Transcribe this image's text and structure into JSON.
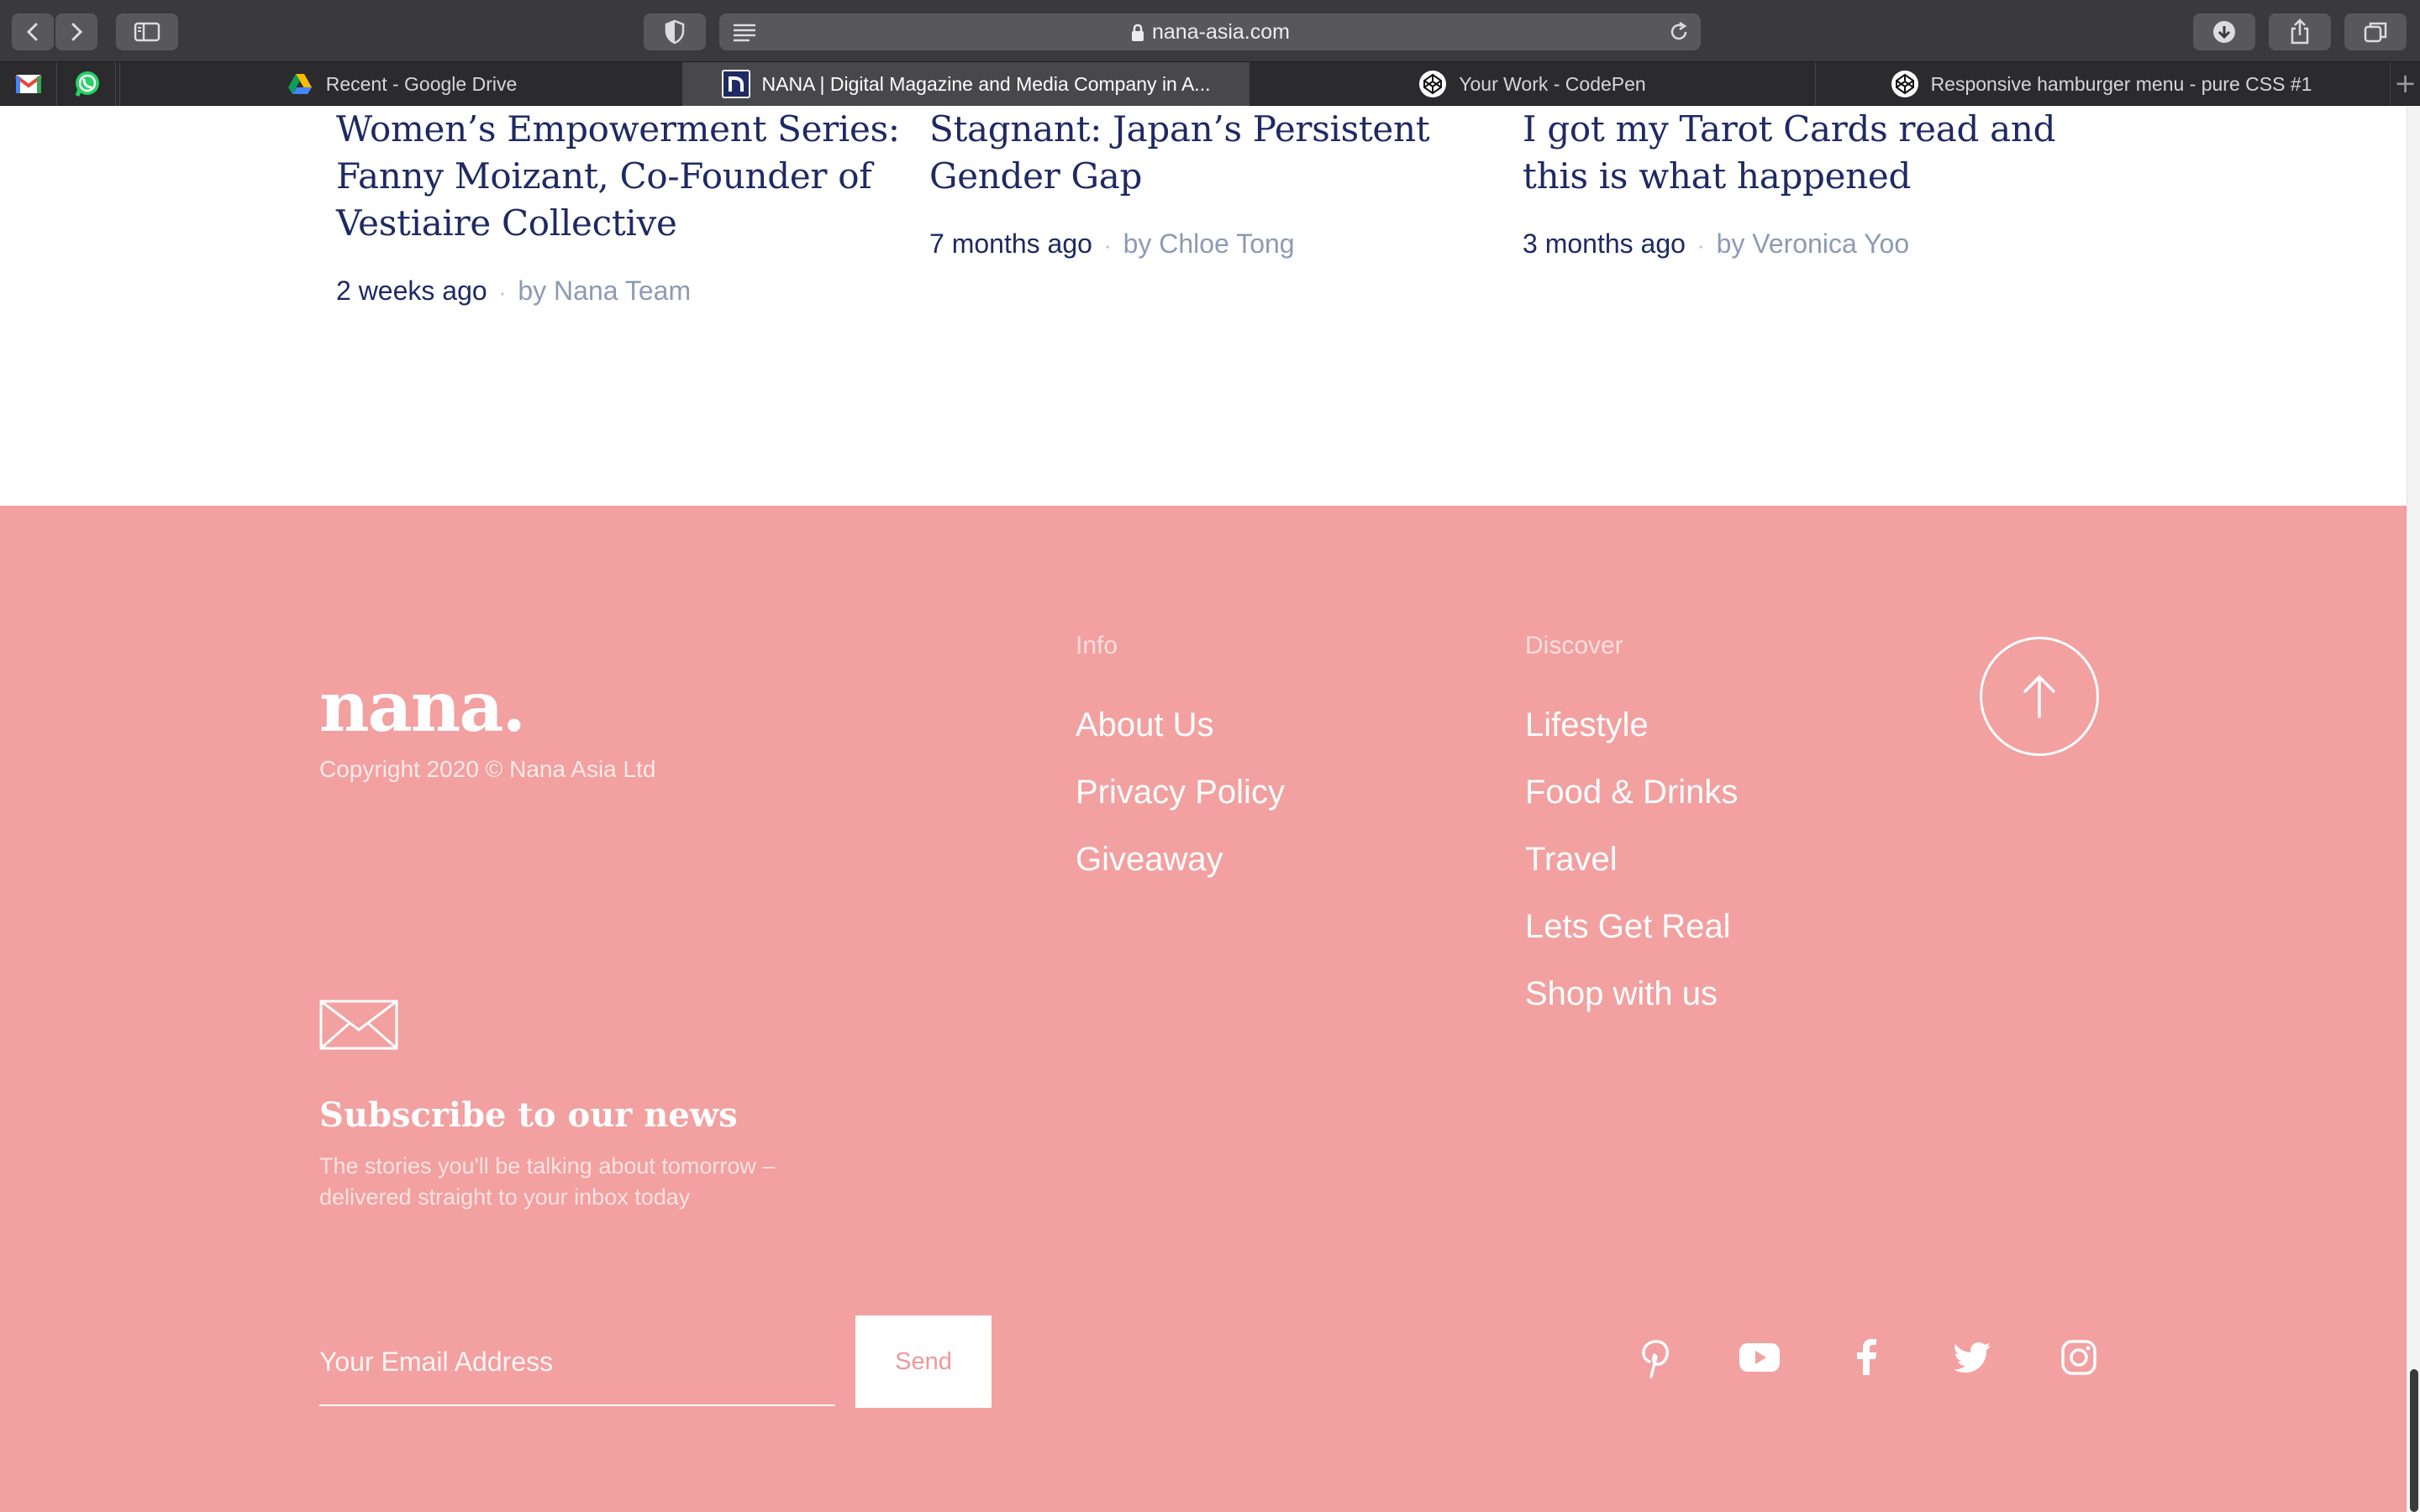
{
  "browser": {
    "url": "nana-asia.com",
    "tabs": [
      {
        "label": "Recent - Google Drive",
        "icon": "google-drive-icon",
        "active": false
      },
      {
        "label": "NANA | Digital Magazine and Media Company in A...",
        "icon": "nana-favicon-icon",
        "active": true
      },
      {
        "label": "Your Work - CodePen",
        "icon": "codepen-icon",
        "active": false
      },
      {
        "label": "Responsive hamburger menu - pure CSS #1",
        "icon": "codepen-icon",
        "active": false
      }
    ],
    "pinned": [
      "gmail-icon",
      "whatsapp-icon"
    ],
    "new_tab_label": "+"
  },
  "articles": [
    {
      "title": "Women’s Empowerment Series: Fanny Moizant, Co-Founder of Vestiaire Collective",
      "time": "2 weeks ago",
      "author": "by Nana Team"
    },
    {
      "title": "Stagnant: Japan’s Persistent Gender Gap",
      "time": "7 months ago",
      "author": "by Chloe Tong"
    },
    {
      "title": "I got my Tarot Cards read and this is what happened",
      "time": "3 months ago",
      "author": "by Veronica Yoo"
    }
  ],
  "footer": {
    "logo": "nana.",
    "copyright": "Copyright 2020 © Nana Asia Ltd",
    "info": {
      "heading": "Info",
      "links": [
        "About Us",
        "Privacy Policy",
        "Giveaway"
      ]
    },
    "discover": {
      "heading": "Discover",
      "links": [
        "Lifestyle",
        "Food & Drinks",
        "Travel",
        "Lets Get Real",
        "Shop with us"
      ]
    },
    "subscribe": {
      "title": "Subscribe to our news",
      "description": "The stories you'll be talking about tomorrow – delivered straight to your inbox today",
      "placeholder": "Your Email Address",
      "button": "Send"
    },
    "social": [
      "pinterest-icon",
      "youtube-icon",
      "facebook-icon",
      "twitter-icon",
      "instagram-icon"
    ],
    "colors": {
      "background": "#f2a0a0",
      "text": "#ffffff",
      "headline": "#1e2a63",
      "author": "#8d9ab4"
    }
  }
}
